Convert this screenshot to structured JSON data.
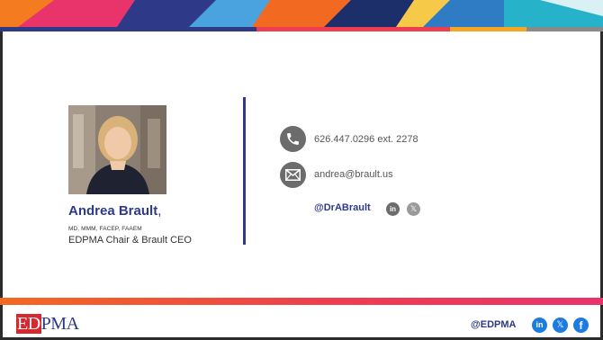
{
  "person": {
    "name": "Andrea Brault",
    "name_suffix": ",",
    "credentials": "MD, MMM, FACEP, FAAEM",
    "title": "EDPMA Chair & Brault CEO"
  },
  "contact": {
    "phone": "626.447.0296 ext. 2278",
    "email": "andrea@brault.us",
    "handle": "@DrABrault"
  },
  "footer": {
    "logo_ed": "ED",
    "logo_pma": "PMA",
    "handle": "@EDPMA"
  },
  "colors": {
    "brand_navy": "#2e3a87",
    "brand_red": "#d7282f",
    "stripe_orange": "#f26a21",
    "stripe_pink": "#e8336b",
    "icon_gray": "#6c6c6c",
    "social_blue": "#1d7ce0"
  },
  "icons": [
    "phone-icon",
    "email-icon",
    "linkedin-icon",
    "x-icon",
    "facebook-icon"
  ]
}
